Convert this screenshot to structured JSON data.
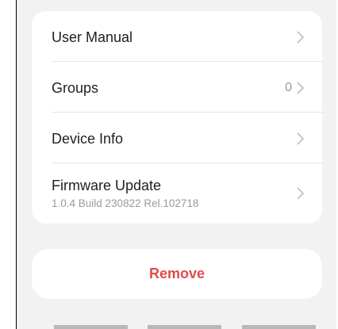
{
  "settings": {
    "items": [
      {
        "label": "User Manual"
      },
      {
        "label": "Groups",
        "count": "0"
      },
      {
        "label": "Device Info"
      },
      {
        "label": "Firmware Update",
        "subtitle": "1.0.4 Build 230822 Rel.102718"
      }
    ]
  },
  "actions": {
    "remove_label": "Remove"
  },
  "colors": {
    "remove": "#e24a4f",
    "background": "#f2f2f3",
    "card": "#ffffff"
  },
  "icons": {
    "row_chevron": "chevron-right-icon"
  }
}
